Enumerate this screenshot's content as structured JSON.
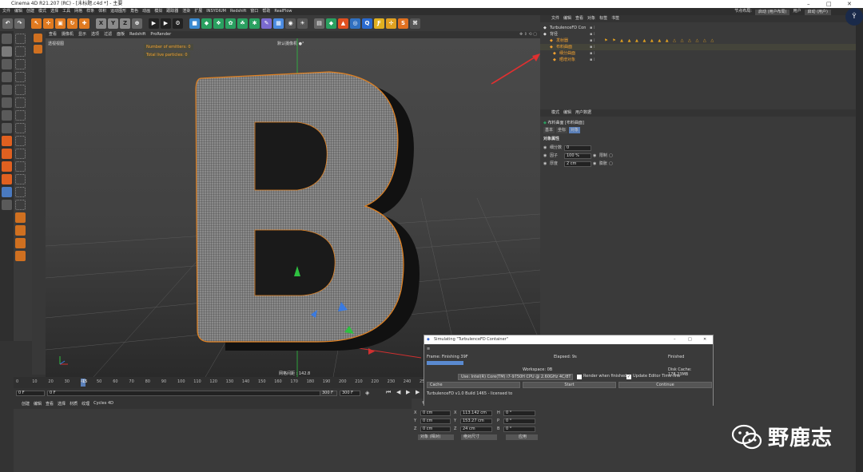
{
  "window": {
    "title": "Cinema 4D R21.207 (RC) - [未标题.c4d *] - 主要"
  },
  "menu": {
    "items": [
      "文件",
      "编辑",
      "创建",
      "模式",
      "选择",
      "工具",
      "网格",
      "样条",
      "体积",
      "运动图形",
      "角色",
      "动画",
      "模拟",
      "跟踪器",
      "渲染",
      "扩展",
      "INSYDIUM",
      "Redshift",
      "窗口",
      "帮助",
      "RealFlow"
    ],
    "layout_label": "节点布局:",
    "layout_value": "启动 (用户布局)",
    "user_label": "用户",
    "user_value": "启动 (用户)"
  },
  "viewport": {
    "menu": [
      "查看",
      "摄像机",
      "显示",
      "选项",
      "过滤",
      "面板",
      "Redshift",
      "ProRender"
    ],
    "view_label": "透视视图",
    "camera_label": "默认摄像机 ●°",
    "hud_emitters": "Number of emitters: 0",
    "hud_particles": "Total live particles: 0",
    "grid_spacing": "网格间距 : 142.8 "
  },
  "timeline": {
    "ticks": [
      "0",
      "10",
      "20",
      "30",
      "40",
      "50",
      "60",
      "70",
      "80",
      "90",
      "100",
      "110",
      "120",
      "130",
      "140",
      "150",
      "160",
      "170",
      "180",
      "190",
      "200",
      "210",
      "220",
      "230",
      "240",
      "250",
      "260",
      "270",
      "280",
      "290",
      "300"
    ],
    "current_frame_marker": "15",
    "start_field": "0 F",
    "current_field": "0 F",
    "end_field": "300 F",
    "max_field": "300 F",
    "right_label": "F"
  },
  "material_manager": {
    "menu": [
      "创建",
      "编辑",
      "查看",
      "选择",
      "材质",
      "纹理",
      "Cycles 4D"
    ]
  },
  "coordinates": {
    "rows": [
      {
        "axis": "X",
        "pos": "0 cm",
        "size_axis": "X",
        "size": "113.142 cm",
        "rot_axis": "H",
        "rot": "0 °"
      },
      {
        "axis": "Y",
        "pos": "0 cm",
        "size_axis": "Y",
        "size": "153.27 cm",
        "rot_axis": "P",
        "rot": "0 °"
      },
      {
        "axis": "Z",
        "pos": "0 cm",
        "size_axis": "Z",
        "size": "24 cm",
        "rot_axis": "B",
        "rot": "0 °"
      }
    ],
    "mode_select": "对象 (相对)",
    "size_select": "绝对尺寸",
    "apply_button": "应用"
  },
  "object_manager": {
    "menu": [
      "文件",
      "编辑",
      "查看",
      "对象",
      "标签",
      "书签"
    ],
    "objects": [
      {
        "name": "TurbulenceFD Con",
        "color": "#dddddd"
      },
      {
        "name": "背径",
        "color": "#dddddd"
      },
      {
        "name": "发射器",
        "color": "#f0a030"
      },
      {
        "name": "布料曲面",
        "color": "#f0a030"
      },
      {
        "name": "细分曲面",
        "color": "#f0a030"
      },
      {
        "name": "晒增对象",
        "color": "#f0a030"
      }
    ]
  },
  "attribute_manager": {
    "menu": [
      "模式",
      "编辑",
      "用户数据"
    ],
    "object_title": "布料曲面 [布料曲面]",
    "tabs": [
      "基本",
      "坐标",
      "对象"
    ],
    "section_title": "对象属性",
    "fields": [
      {
        "label": "细分数",
        "value": "0"
      },
      {
        "label": "因子",
        "value": "100 %",
        "check_label": "限制"
      },
      {
        "label": "厚度",
        "value": "2 cm",
        "check_label": "膨胀"
      }
    ]
  },
  "sim_dialog": {
    "title": "Simulating \"TurbulenceFD Container\"",
    "frame_label": "Frame: Finishing 39F",
    "elapsed": "Elapsed: 9s",
    "status": "Finished",
    "workspace": "Workspace: 0B",
    "disk_cache": "Disk Cache: 178.23MB",
    "cpu_select": "Use: Intel(R) Core(TM) i7-9750H CPU @ 2.60GHz 4C/8T",
    "render_when_finished": "Render when finished",
    "update_timeline": "Update Editor Time-line",
    "cache_select": "Cache",
    "start_button": "Start",
    "continue_button": "Continue",
    "footer": "TurbulenceFD v1.0 Build 1465 - licensed to"
  },
  "watermark": {
    "text": "野鹿志"
  },
  "colors": {
    "accent": "#f0a030",
    "selection": "#5a7fb8",
    "arrow": "#e03030"
  }
}
